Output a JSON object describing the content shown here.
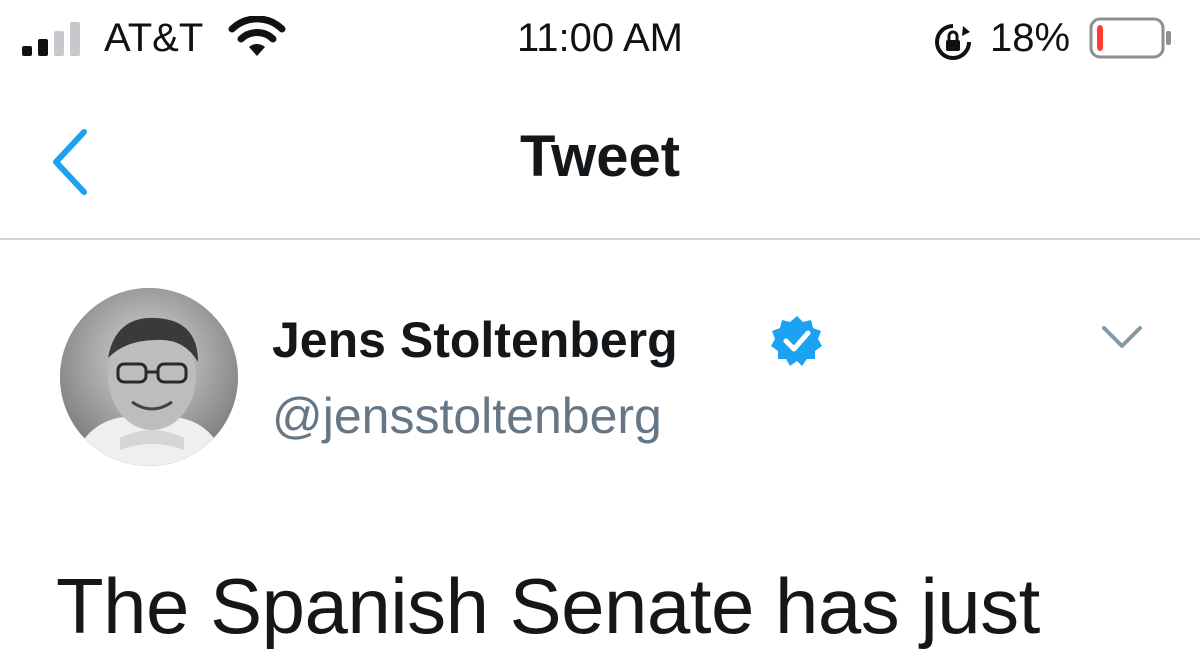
{
  "status_bar": {
    "carrier": "AT&T",
    "time": "11:00 AM",
    "battery_percent": "18%",
    "battery_level": 0.18,
    "signal_bars_filled": 2,
    "signal_bars_total": 4,
    "battery_color": "#ff3b30"
  },
  "nav": {
    "title": "Tweet",
    "back_icon": "chevron-left-icon",
    "accent": "#1da1f2"
  },
  "tweet": {
    "author_name": "Jens Stoltenberg",
    "author_handle": "@jensstoltenberg",
    "verified": true,
    "text": "The Spanish Senate has just",
    "menu_icon": "chevron-down-icon"
  }
}
